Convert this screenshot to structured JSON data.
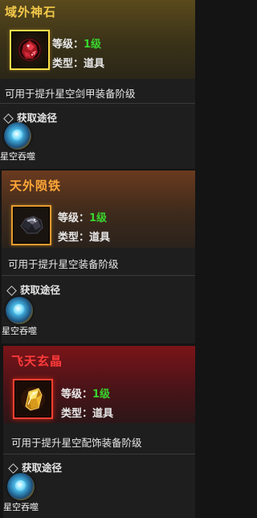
{
  "items": [
    {
      "name": "域外神石",
      "level_label": "等级：",
      "level_value": "1级",
      "type_label": "类型：",
      "type_value": "道具",
      "description": "可用于提升星空剑甲装备阶级",
      "source_header": "获取途径",
      "source_label": "星空吞噬",
      "icon": "red-gem-icon",
      "name_color": "#f2c84a"
    },
    {
      "name": "天外陨铁",
      "level_label": "等级：",
      "level_value": "1级",
      "type_label": "类型：",
      "type_value": "道具",
      "description": "可用于提升星空装备阶级",
      "source_header": "获取途径",
      "source_label": "星空吞噬",
      "icon": "black-meteorite-icon",
      "name_color": "#ffa838"
    },
    {
      "name": "飞天玄晶",
      "level_label": "等级：",
      "level_value": "1级",
      "type_label": "类型：",
      "type_value": "道具",
      "description": "可用于提升星空配饰装备阶级",
      "source_header": "获取途径",
      "source_label": "星空吞噬",
      "icon": "gold-crystal-icon",
      "name_color": "#ff3a3a"
    }
  ],
  "colors": {
    "level_value": "#39d42e",
    "text": "#e6e6e6",
    "panel_bg": "#1e1e1e"
  }
}
